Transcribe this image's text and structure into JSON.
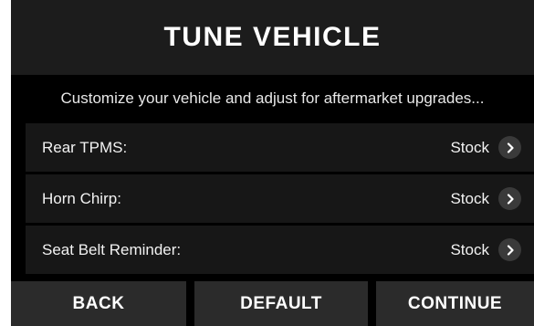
{
  "header": {
    "title": "TUNE VEHICLE"
  },
  "subtitle": "Customize your vehicle and adjust for aftermarket upgrades...",
  "settings": [
    {
      "label": "Rear TPMS:",
      "value": "Stock"
    },
    {
      "label": "Horn Chirp:",
      "value": "Stock"
    },
    {
      "label": "Seat Belt Reminder:",
      "value": "Stock"
    }
  ],
  "footer": {
    "back_label": "BACK",
    "default_label": "DEFAULT",
    "continue_label": "CONTINUE"
  },
  "icons": {
    "row_action": "chevron-right-icon"
  },
  "colors": {
    "background": "#000000",
    "header_bg": "#1c1c1c",
    "row_bg": "#171717",
    "button_bg": "#2b2b2b",
    "chevron_bg": "#3a3a3a",
    "text": "#ffffff"
  }
}
